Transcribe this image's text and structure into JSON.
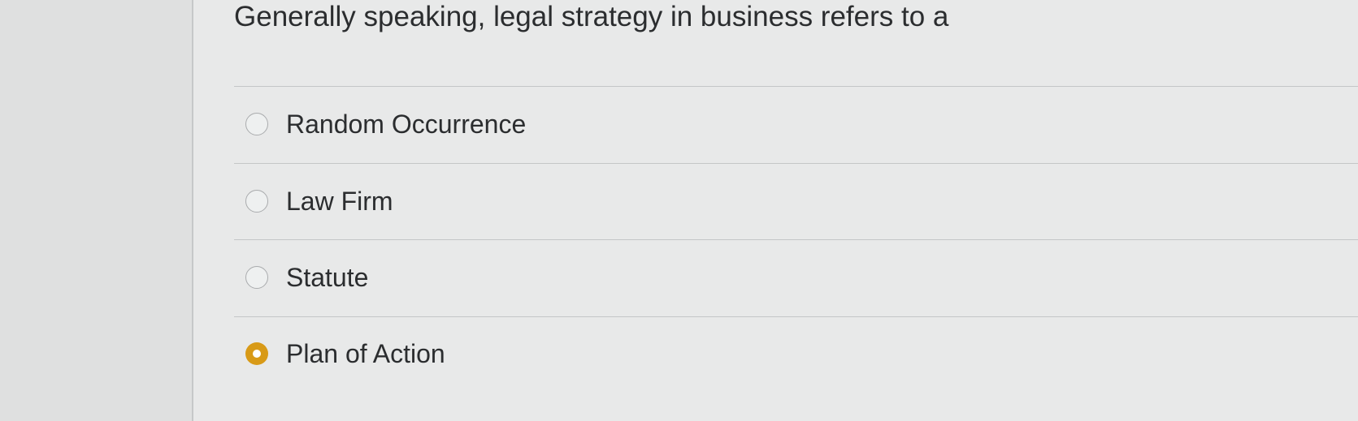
{
  "question": {
    "text": "Generally speaking, legal strategy in business refers to a"
  },
  "options": [
    {
      "label": "Random Occurrence",
      "selected": false
    },
    {
      "label": "Law Firm",
      "selected": false
    },
    {
      "label": "Statute",
      "selected": false
    },
    {
      "label": "Plan of Action",
      "selected": true
    }
  ],
  "colors": {
    "selected_accent": "#d89a17",
    "text": "#2b2d2f",
    "divider": "#c4c6c7"
  }
}
